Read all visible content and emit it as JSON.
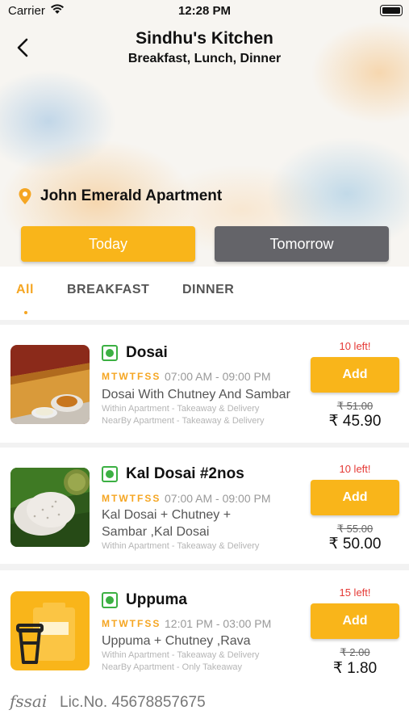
{
  "status_bar": {
    "carrier": "Carrier",
    "time": "12:28 PM"
  },
  "header": {
    "title": "Sindhu's Kitchen",
    "subtitle": "Breakfast, Lunch, Dinner"
  },
  "location": {
    "label": "John Emerald Apartment"
  },
  "day_toggle": {
    "today": "Today",
    "tomorrow": "Tomorrow",
    "selected": "Today"
  },
  "tabs": [
    {
      "label": "All",
      "active": true
    },
    {
      "label": "BREAKFAST",
      "active": false
    },
    {
      "label": "DINNER",
      "active": false
    }
  ],
  "items": [
    {
      "name": "Dosai",
      "days": "MTWTFSS",
      "hours": "07:00 AM - 09:00 PM",
      "description": "Dosai With Chutney And Sambar",
      "availability": [
        "Within Apartment - Takeaway & Delivery",
        "NearBy Apartment - Takeaway & Delivery"
      ],
      "stock": "10 left!",
      "add_label": "Add",
      "old_price": "₹ 51.00",
      "price": "₹ 45.90",
      "veg": true
    },
    {
      "name": "Kal Dosai #2nos",
      "days": "MTWTFSS",
      "hours": "07:00 AM - 09:00 PM",
      "description": "Kal Dosai + Chutney + Sambar ,Kal Dosai",
      "availability": [
        "Within Apartment - Takeaway & Delivery"
      ],
      "stock": "10 left!",
      "add_label": "Add",
      "old_price": "₹ 55.00",
      "price": "₹ 50.00",
      "veg": true
    },
    {
      "name": "Uppuma",
      "days": "MTWTFSS",
      "hours": "12:01 PM - 03:00 PM",
      "description": "Uppuma + Chutney ,Rava",
      "availability": [
        "Within Apartment - Takeaway & Delivery",
        "NearBy Apartment - Only Takeaway"
      ],
      "stock": "15 left!",
      "add_label": "Add",
      "old_price": "₹ 2.00",
      "price": "₹ 1.80",
      "veg": true
    }
  ],
  "footer": {
    "fssai_logo": "fssai",
    "license": "Lic.No. 45678857675"
  },
  "colors": {
    "accent": "#f9b51a",
    "tab_active": "#f5a623",
    "secondary_button": "#646469",
    "stock_red": "#e53935",
    "veg_green": "#3cb043"
  },
  "icons": [
    "back-chevron-icon",
    "wifi-icon",
    "battery-icon",
    "location-pin-icon",
    "veg-indicator-icon"
  ]
}
